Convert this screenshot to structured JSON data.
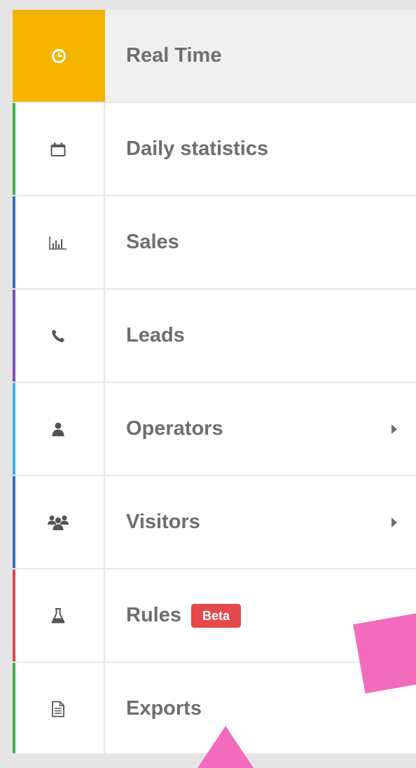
{
  "menu": {
    "items": [
      {
        "label": "Real Time",
        "icon": "clock-icon",
        "accent": "#f5b400",
        "active": true
      },
      {
        "label": "Daily statistics",
        "icon": "calendar-icon",
        "accent": "#3ab54a"
      },
      {
        "label": "Sales",
        "icon": "bar-chart-icon",
        "accent": "#2f6fc5"
      },
      {
        "label": "Leads",
        "icon": "phone-icon",
        "accent": "#7b4fc4"
      },
      {
        "label": "Operators",
        "icon": "user-icon",
        "accent": "#35b2e8",
        "submenu": true
      },
      {
        "label": "Visitors",
        "icon": "users-icon",
        "accent": "#2f6fc5",
        "submenu": true
      },
      {
        "label": "Rules",
        "icon": "flask-icon",
        "accent": "#e5484a",
        "badge": "Beta"
      },
      {
        "label": "Exports",
        "icon": "document-icon",
        "accent": "#3ab54a"
      }
    ]
  },
  "colors": {
    "active_bg": "#f5b400",
    "label": "#6e6e6e",
    "badge": "#e5484a",
    "sticker": "#f36bbd"
  }
}
